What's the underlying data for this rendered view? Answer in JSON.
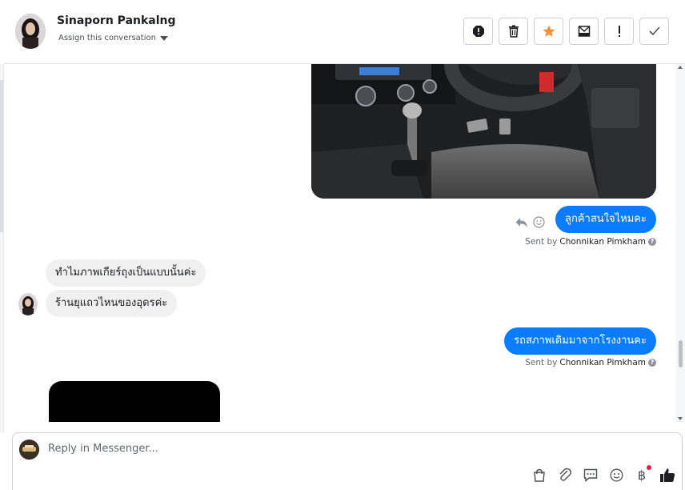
{
  "header": {
    "contact_name": "Sinaporn Pankalng",
    "assign_label": "Assign this conversation",
    "toolbar_icons": [
      "spam-icon",
      "trash-icon",
      "star-icon",
      "inbox-move-icon",
      "mark-unread-icon",
      "done-icon"
    ]
  },
  "colors": {
    "outgoing_bubble": "#0a7cff",
    "incoming_bubble": "#f0f0f0",
    "star": "#f7923a"
  },
  "thread": {
    "messages": [
      {
        "direction": "out",
        "type": "image",
        "description_icon": "car-interior-photo"
      },
      {
        "direction": "out",
        "type": "text",
        "text": "ลูกค้าสนใจไหมคะ"
      },
      {
        "direction": "in",
        "type": "text",
        "text": "ทำไมภาพเกียร์ถุงเป็นแบบนั้นค่ะ"
      },
      {
        "direction": "in",
        "type": "text",
        "text": "ร้านยุแถวไหนของอุดรค่ะ"
      },
      {
        "direction": "out",
        "type": "text",
        "text": "รถสภาพเดิมมาจากโรงงานคะ"
      },
      {
        "direction": "in",
        "type": "image"
      }
    ],
    "sent_by_prefix": "Sent by",
    "sent_by_name": "Chonnikan Pimkham"
  },
  "composer": {
    "placeholder": "Reply in Messenger...",
    "tools": [
      "shop-icon",
      "attach-icon",
      "saved-reply-icon",
      "emoji-icon",
      "baht-payment-icon",
      "like-icon"
    ]
  }
}
